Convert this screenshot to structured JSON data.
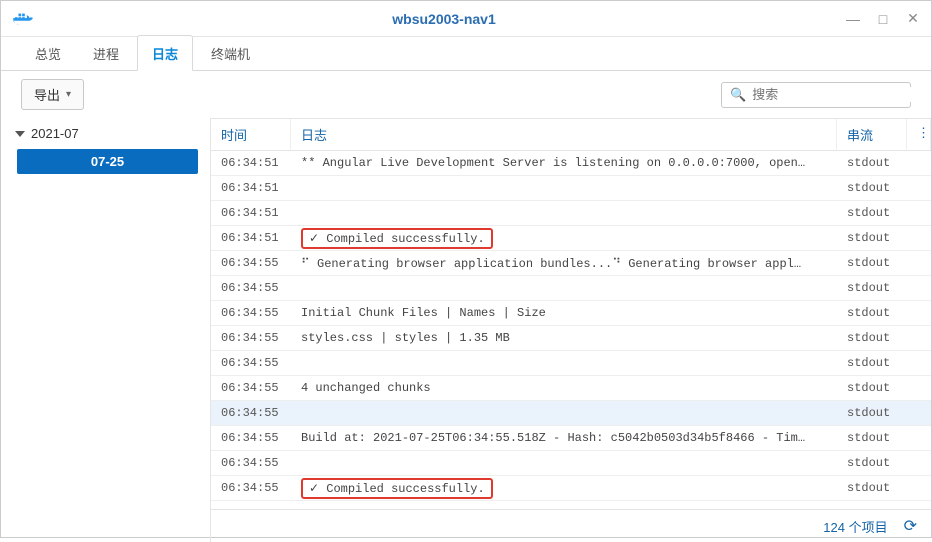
{
  "window": {
    "title": "wbsu2003-nav1"
  },
  "tabs": {
    "items": [
      {
        "label": "总览"
      },
      {
        "label": "进程"
      },
      {
        "label": "日志",
        "active": true
      },
      {
        "label": "终端机"
      }
    ]
  },
  "toolbar": {
    "export_label": "导出",
    "search_placeholder": "搜索"
  },
  "sidebar": {
    "month": "2021-07",
    "selected_day": "07-25"
  },
  "table": {
    "headers": {
      "time": "时间",
      "log": "日志",
      "stream": "串流"
    },
    "rows": [
      {
        "time": "06:34:51",
        "log": "** Angular Live Development Server is listening on 0.0.0.0:7000, open…",
        "stream": "stdout"
      },
      {
        "time": "06:34:51",
        "log": "",
        "stream": "stdout"
      },
      {
        "time": "06:34:51",
        "log": "",
        "stream": "stdout"
      },
      {
        "time": "06:34:51",
        "log": "✓ Compiled successfully.",
        "stream": "stdout",
        "highlight": true
      },
      {
        "time": "06:34:55",
        "log": "⠋ Generating browser application bundles...⠙ Generating browser appl…",
        "stream": "stdout"
      },
      {
        "time": "06:34:55",
        "log": "",
        "stream": "stdout"
      },
      {
        "time": "06:34:55",
        "log": "Initial Chunk Files | Names  |      Size",
        "stream": "stdout"
      },
      {
        "time": "06:34:55",
        "log": "styles.css          | styles |   1.35 MB",
        "stream": "stdout"
      },
      {
        "time": "06:34:55",
        "log": "",
        "stream": "stdout"
      },
      {
        "time": "06:34:55",
        "log": "4 unchanged chunks",
        "stream": "stdout"
      },
      {
        "time": "06:34:55",
        "log": "",
        "stream": "stdout",
        "selected": true
      },
      {
        "time": "06:34:55",
        "log": "Build at: 2021-07-25T06:34:55.518Z - Hash: c5042b0503d34b5f8466 - Tim…",
        "stream": "stdout"
      },
      {
        "time": "06:34:55",
        "log": "",
        "stream": "stdout"
      },
      {
        "time": "06:34:55",
        "log": "✓ Compiled successfully.",
        "stream": "stdout",
        "highlight": true
      }
    ]
  },
  "footer": {
    "count_text": "124 个项目"
  }
}
